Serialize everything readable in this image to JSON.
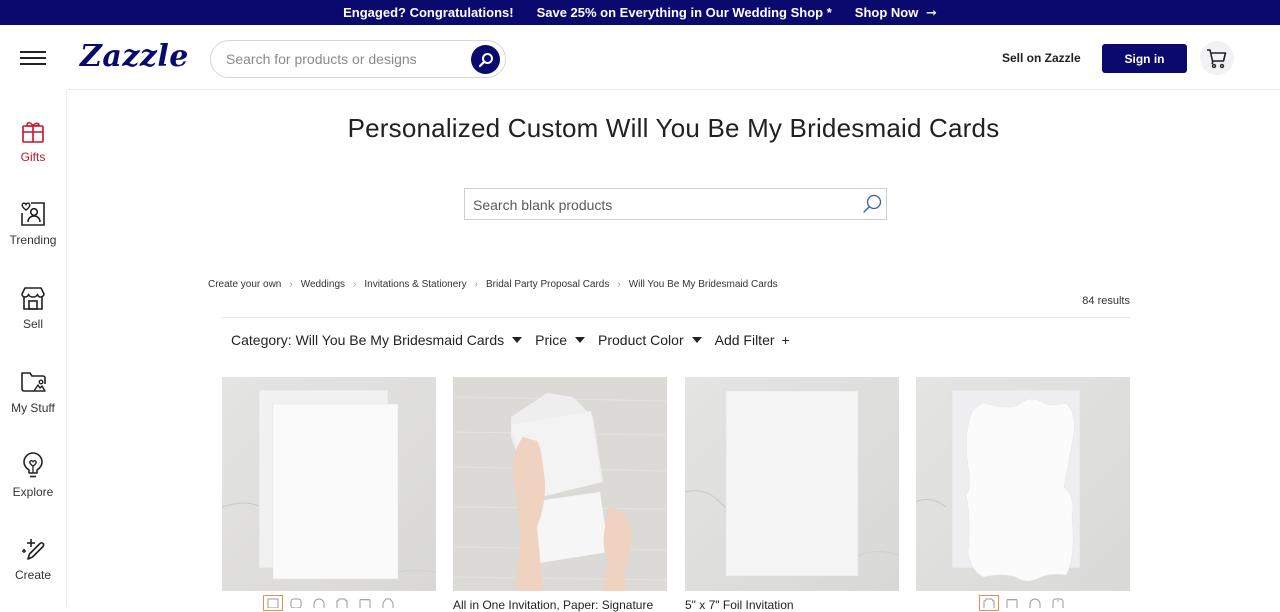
{
  "promo": {
    "text1": "Engaged? Congratulations!",
    "text2": "Save 25% on Everything in Our Wedding Shop *",
    "cta": "Shop Now",
    "cta_icon": "arrow-right-icon"
  },
  "header": {
    "logo": "Zazzle",
    "search_placeholder": "Search for products or designs",
    "sell_link": "Sell on Zazzle",
    "sign_in": "Sign in",
    "colors": {
      "brand": "#0a0a6e",
      "accent": "#c8102e"
    }
  },
  "sidebar": {
    "items": [
      {
        "label": "Gifts",
        "icon": "gift-icon",
        "active": true
      },
      {
        "label": "Trending",
        "icon": "trending-icon",
        "active": false
      },
      {
        "label": "Sell",
        "icon": "storefront-icon",
        "active": false
      },
      {
        "label": "My Stuff",
        "icon": "folder-icon",
        "active": false
      },
      {
        "label": "Explore",
        "icon": "lightbulb-icon",
        "active": false
      },
      {
        "label": "Create",
        "icon": "pencil-sparkle-icon",
        "active": false
      }
    ]
  },
  "main": {
    "title": "Personalized Custom Will You Be My Bridesmaid Cards",
    "blank_search_placeholder": "Search blank products",
    "breadcrumb": [
      "Create your own",
      "Weddings",
      "Invitations & Stationery",
      "Bridal Party Proposal Cards",
      "Will You Be My Bridesmaid Cards"
    ],
    "results": "84 results",
    "filters": [
      {
        "label": "Category: Will You Be My Bridesmaid Cards",
        "type": "dropdown"
      },
      {
        "label": "Price",
        "type": "dropdown"
      },
      {
        "label": "Product Color",
        "type": "dropdown"
      },
      {
        "label": "Add Filter",
        "type": "add"
      }
    ],
    "products": [
      {
        "title": "",
        "image": "blank flat card with envelope on marble",
        "swatches": [
          "rectangle",
          "rounded",
          "arch",
          "bracket",
          "scalloped",
          "octagon"
        ],
        "selected_swatch": 0
      },
      {
        "title": "All in One Invitation, Paper: Signature",
        "image": "hands holding all-in-one tear-off invitation",
        "swatches": [],
        "selected_swatch": null
      },
      {
        "title": "5\" x 7\" Foil Invitation",
        "image": "blank flat card on marble",
        "swatches": [],
        "selected_swatch": null
      },
      {
        "title": "",
        "image": "bracket-shaped card with envelope on marble",
        "swatches": [
          "bracket",
          "scalloped",
          "arch",
          "ticket"
        ],
        "selected_swatch": 0
      }
    ]
  }
}
